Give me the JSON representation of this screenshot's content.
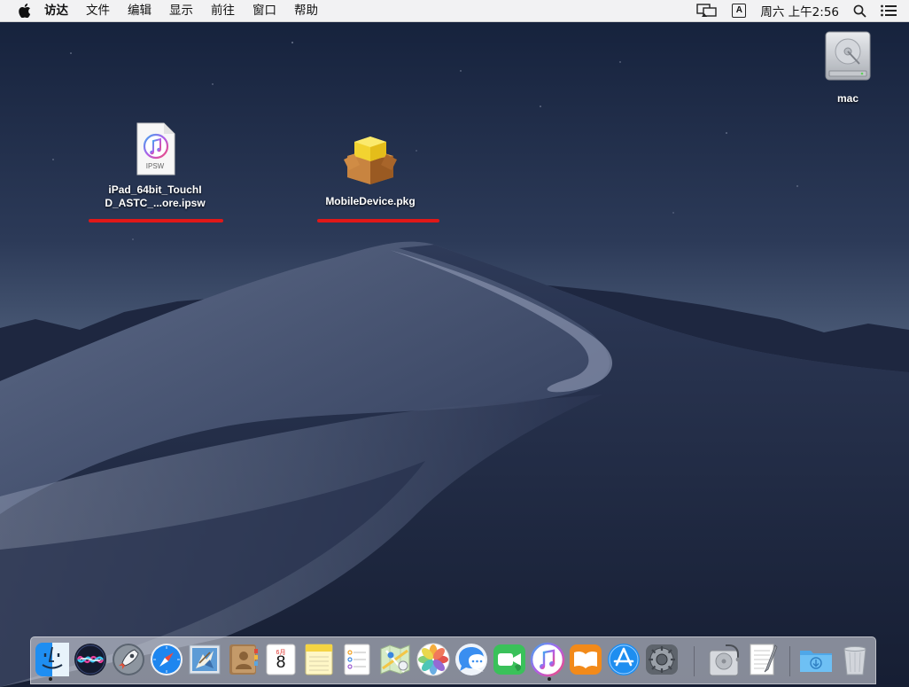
{
  "menubar": {
    "app_name": "访达",
    "menus": [
      "文件",
      "编辑",
      "显示",
      "前往",
      "窗口",
      "帮助"
    ],
    "input_method": "A",
    "clock": "周六 上午2:56"
  },
  "desktop": {
    "icons": [
      {
        "name": "ipsw-file-icon",
        "type_label": "IPSW",
        "label": "iPad_64bit_TouchI\nD_ASTC_...ore.ipsw",
        "underlined": true
      },
      {
        "name": "pkg-file-icon",
        "label": "MobileDevice.pkg",
        "underlined": true
      },
      {
        "name": "hard-drive-icon",
        "label": "mac",
        "underlined": false
      }
    ],
    "underline_color": "#e01818"
  },
  "dock": {
    "apps": [
      "Finder",
      "Siri",
      "Launchpad",
      "Safari",
      "Mail",
      "Contacts",
      "Calendar",
      "Notes",
      "Reminders",
      "Maps",
      "Photos",
      "Messages",
      "FaceTime",
      "iTunes",
      "Books",
      "App Store",
      "System Preferences",
      "Disk Utility",
      "TextEdit",
      "Downloads",
      "Trash"
    ],
    "calendar_month": "6月",
    "calendar_day": "8",
    "running": [
      "Finder",
      "iTunes"
    ]
  }
}
